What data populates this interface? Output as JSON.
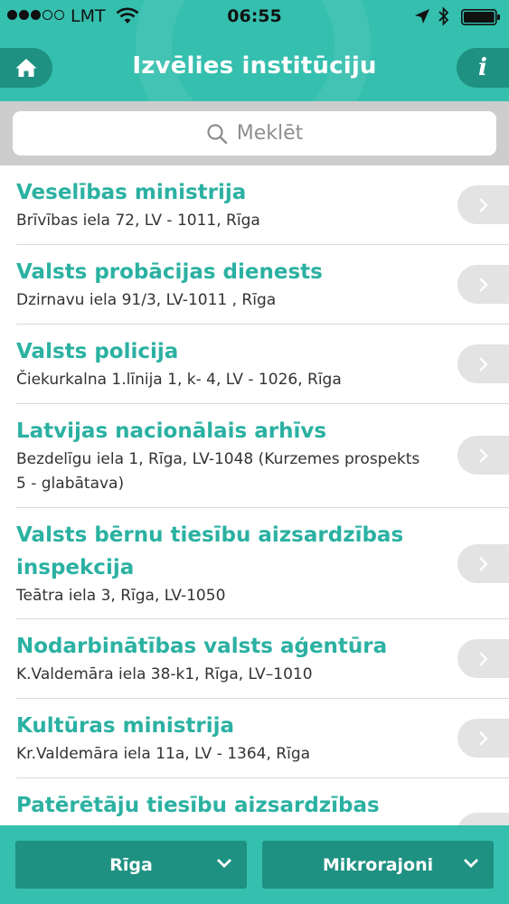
{
  "status_bar": {
    "carrier": "LMT",
    "time": "06:55"
  },
  "nav": {
    "title": "Izvēlies institūciju",
    "info_label": "i"
  },
  "search": {
    "placeholder": "Meklēt"
  },
  "institutions": [
    {
      "name": "Veselības ministrija",
      "address": "Brīvības iela 72, LV - 1011, Rīga"
    },
    {
      "name": "Valsts probācijas dienests",
      "address": "Dzirnavu iela 91/3, LV-1011 , Rīga"
    },
    {
      "name": "Valsts policija",
      "address": "Čiekurkalna 1.līnija 1, k- 4, LV - 1026, Rīga"
    },
    {
      "name": "Latvijas nacionālais arhīvs",
      "address": "Bezdelīgu iela 1, Rīga, LV-1048 (Kurzemes prospekts 5 - glabātava)"
    },
    {
      "name": "Valsts bērnu tiesību aizsardzības inspekcija",
      "address": "Teātra iela 3, Rīga, LV-1050"
    },
    {
      "name": "Nodarbinātības valsts aģentūra",
      "address": "K.Valdemāra iela 38-k1, Rīga, LV–1010"
    },
    {
      "name": "Kultūras ministrija",
      "address": "Kr.Valdemāra iela 11a, LV - 1364, Rīga"
    },
    {
      "name": "Patērētāju tiesību aizsardzības",
      "address": ""
    }
  ],
  "filters": {
    "city": "Rīga",
    "district": "Mikrorajoni"
  },
  "colors": {
    "accent": "#35bfae",
    "accent_dark": "#1e9182",
    "title_text": "#2bb1a2"
  }
}
